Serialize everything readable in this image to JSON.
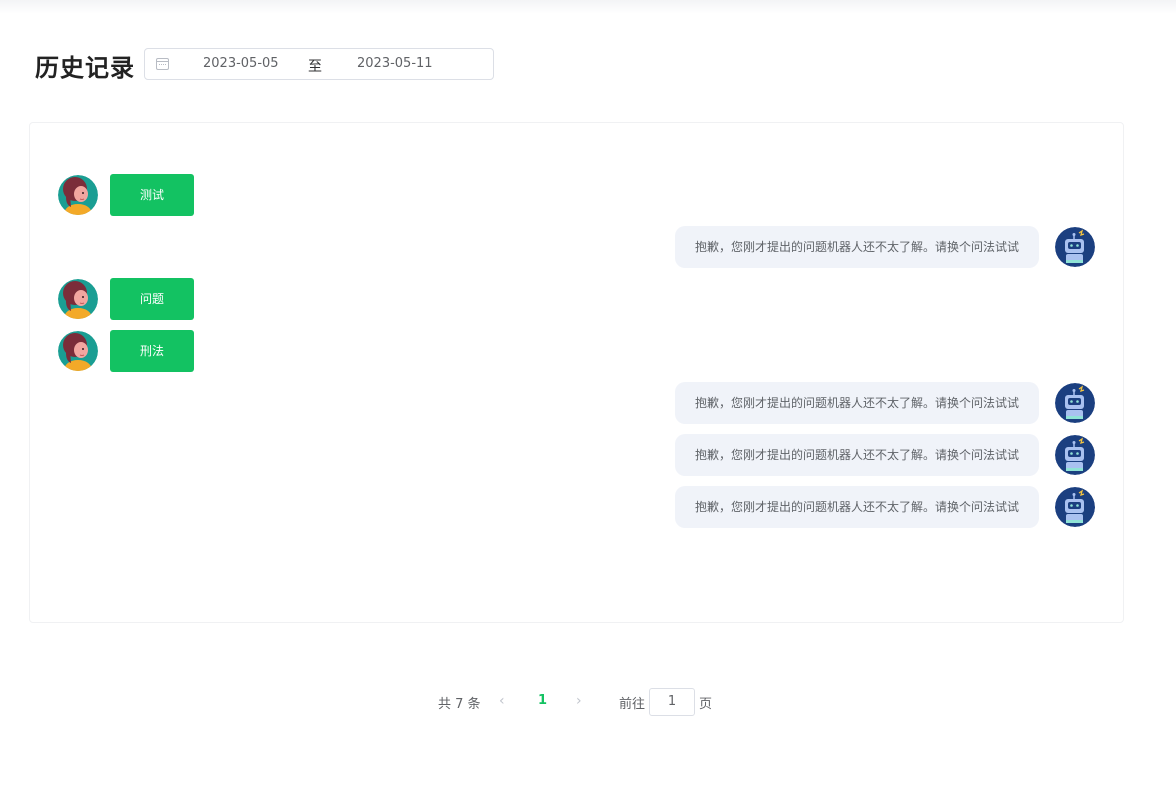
{
  "header": {
    "title": "历史记录",
    "date_range": {
      "start": "2023-05-05",
      "separator": "至",
      "end": "2023-05-11",
      "icon": "calendar-icon"
    }
  },
  "messages": [
    {
      "role": "user",
      "text": "测试"
    },
    {
      "role": "bot",
      "text": "抱歉，您刚才提出的问题机器人还不太了解。请换个问法试试"
    },
    {
      "role": "user",
      "text": "问题"
    },
    {
      "role": "user",
      "text": "刑法"
    },
    {
      "role": "bot",
      "text": "抱歉，您刚才提出的问题机器人还不太了解。请换个问法试试"
    },
    {
      "role": "bot",
      "text": "抱歉，您刚才提出的问题机器人还不太了解。请换个问法试试"
    },
    {
      "role": "bot",
      "text": "抱歉，您刚才提出的问题机器人还不太了解。请换个问法试试"
    }
  ],
  "pagination": {
    "total": "共 7 条",
    "prev_icon": "‹",
    "current_page": "1",
    "next_icon": "›",
    "goto_label": "前往",
    "goto_value": "1",
    "goto_unit": "页"
  },
  "colors": {
    "accent": "#13c262",
    "bot_bubble": "#f0f3f9",
    "bot_avatar": "#1b3f80"
  }
}
